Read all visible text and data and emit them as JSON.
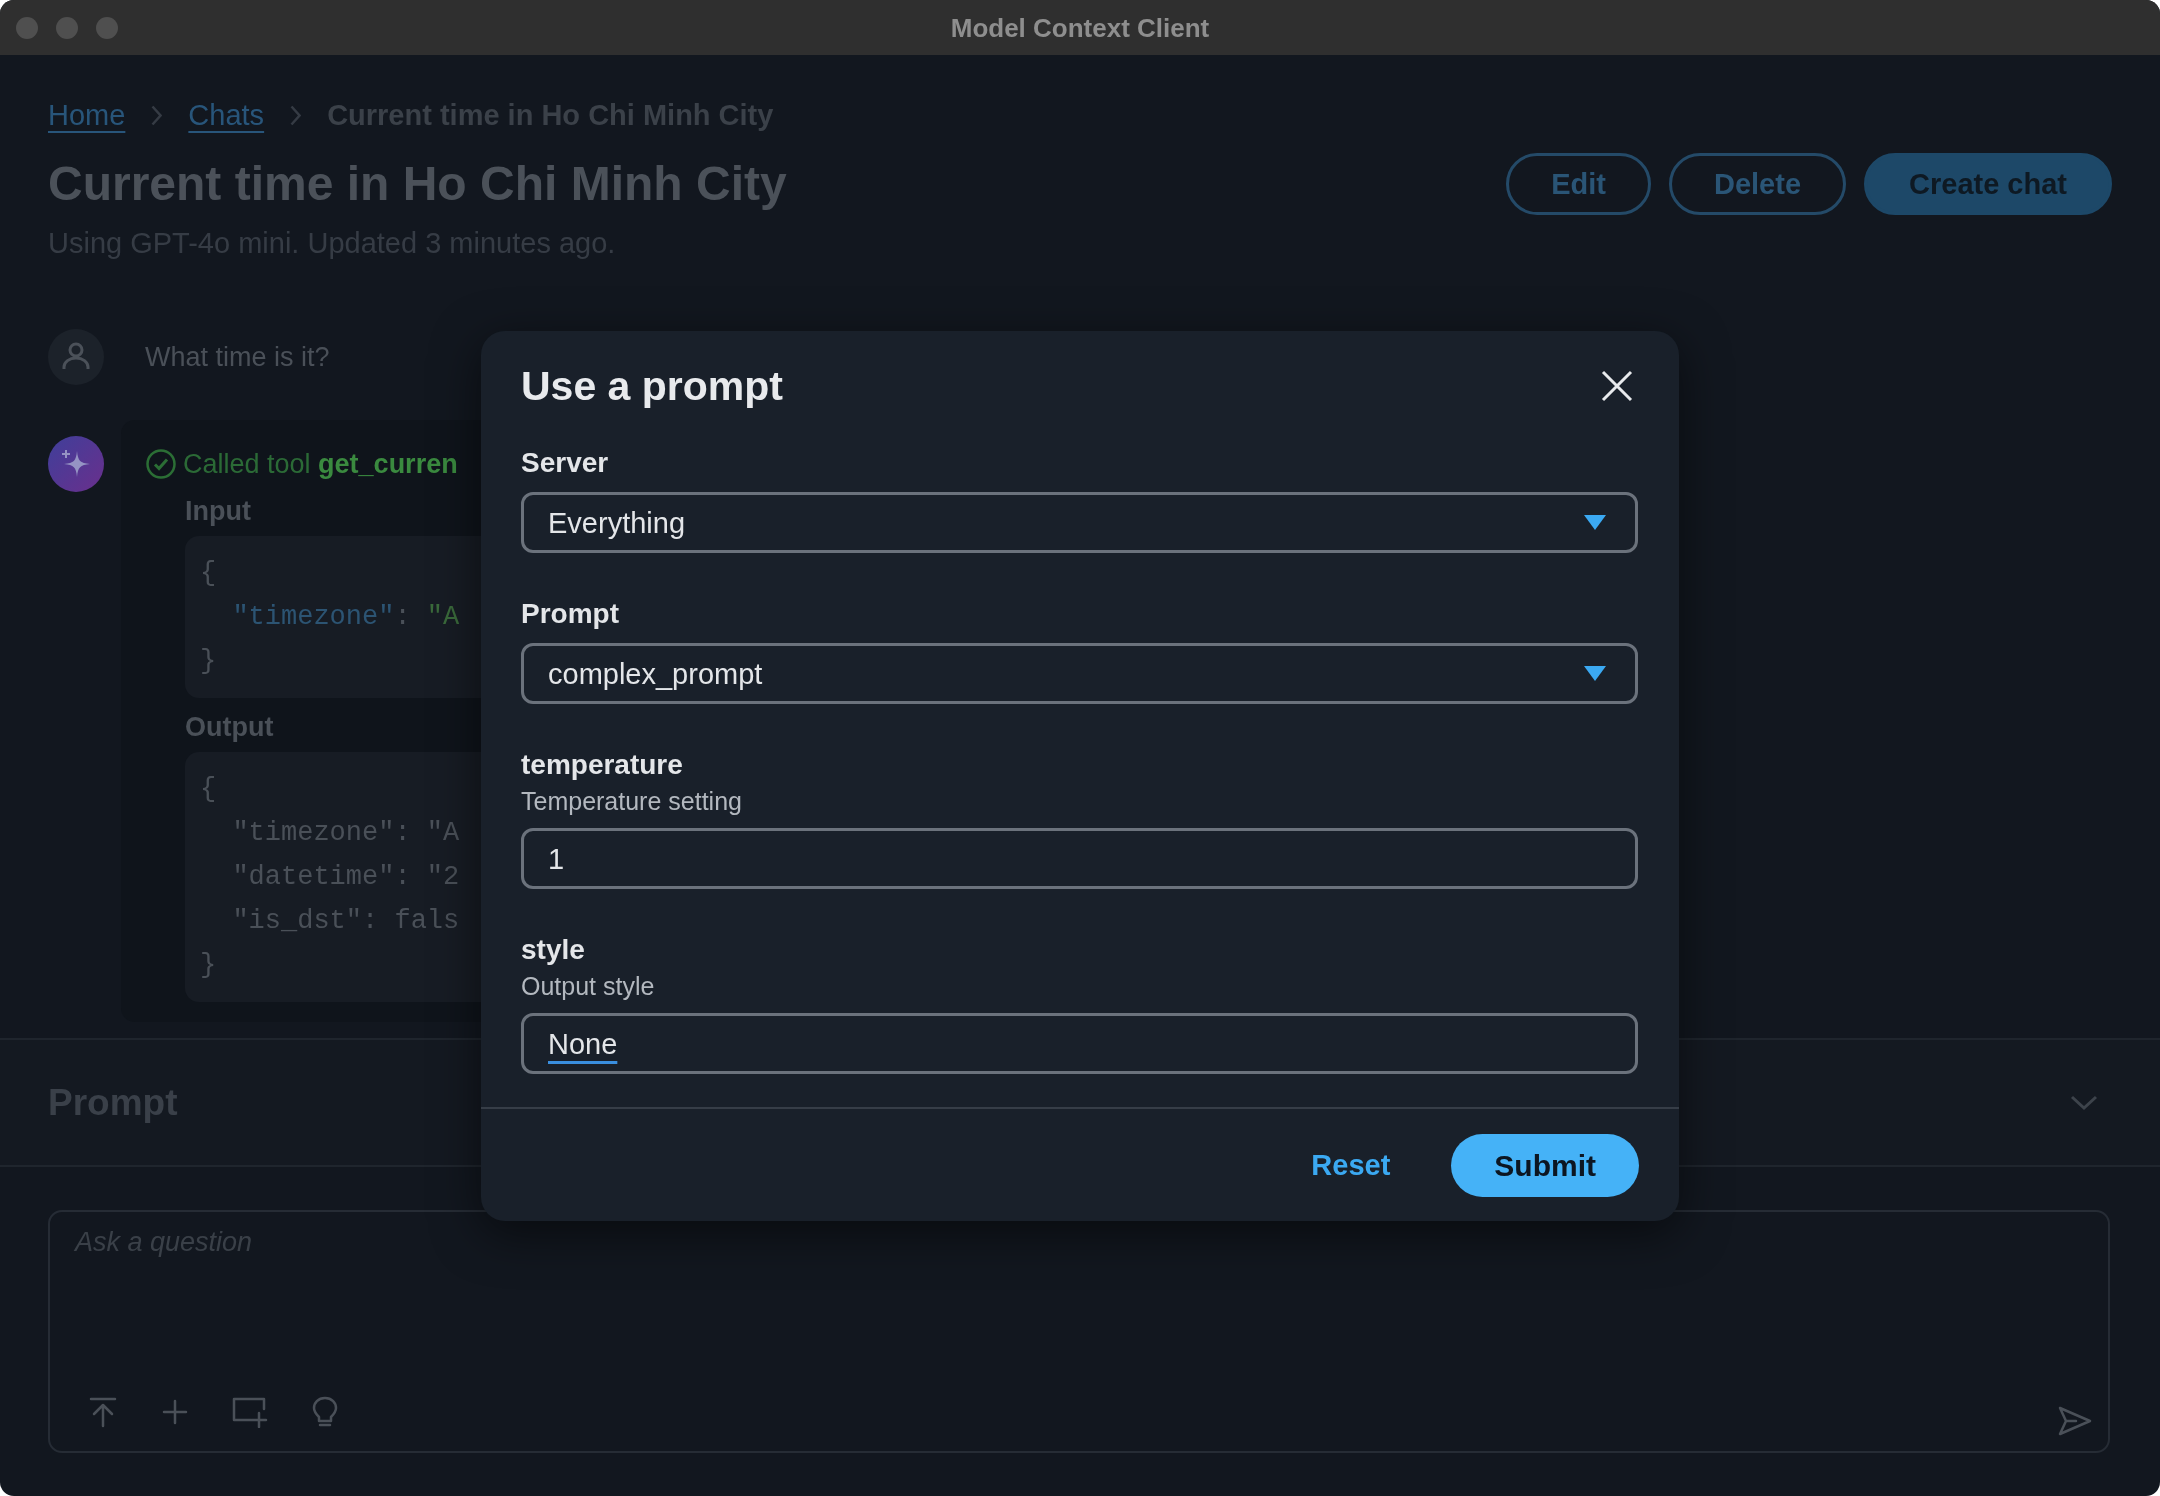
{
  "window": {
    "title": "Model Context Client"
  },
  "breadcrumb": [
    {
      "label": "Home",
      "kind": "link"
    },
    {
      "label": "Chats",
      "kind": "link"
    },
    {
      "label": "Current time in Ho Chi Minh City",
      "kind": "current"
    }
  ],
  "page": {
    "title": "Current time in Ho Chi Minh City",
    "subtitle": "Using GPT-4o mini. Updated 3 minutes ago.",
    "actions": [
      {
        "label": "Edit",
        "kind": "outlined"
      },
      {
        "label": "Delete",
        "kind": "outlined"
      },
      {
        "label": "Create chat",
        "kind": "filled"
      }
    ]
  },
  "messages": [
    {
      "kind": "user",
      "text": "What time is it?"
    },
    {
      "kind": "assistant",
      "tool_call": {
        "succeeded": true,
        "text": "Called tool **get_curren**",
        "sections": [
          {
            "label": "Input",
            "highlighted": true,
            "lines": [
              "{",
              "  \"timezone\": \"A",
              "}"
            ]
          },
          {
            "label": "Output",
            "highlighted": false,
            "lines": [
              "{",
              "  \"timezone\": \"A",
              "  \"datetime\": \"2",
              "  \"is_dst\": fals",
              "}"
            ]
          }
        ]
      }
    }
  ],
  "prompt_panel": {
    "title": "Prompt",
    "expanded": false
  },
  "composer": {
    "placeholder": "Ask a question"
  },
  "dialog": {
    "title": "Use a prompt",
    "fields": [
      {
        "label": "Server",
        "kind": "select",
        "value": "Everything"
      },
      {
        "label": "Prompt",
        "kind": "select",
        "value": "complex_prompt"
      },
      {
        "label": "temperature",
        "description": "Temperature setting",
        "kind": "input",
        "value": "1",
        "underlined": false
      },
      {
        "label": "style",
        "description": "Output style",
        "kind": "input",
        "value": "None",
        "underlined": true
      }
    ],
    "actions": [
      {
        "label": "Reset",
        "kind": "text"
      },
      {
        "label": "Submit",
        "kind": "filled"
      }
    ]
  }
}
